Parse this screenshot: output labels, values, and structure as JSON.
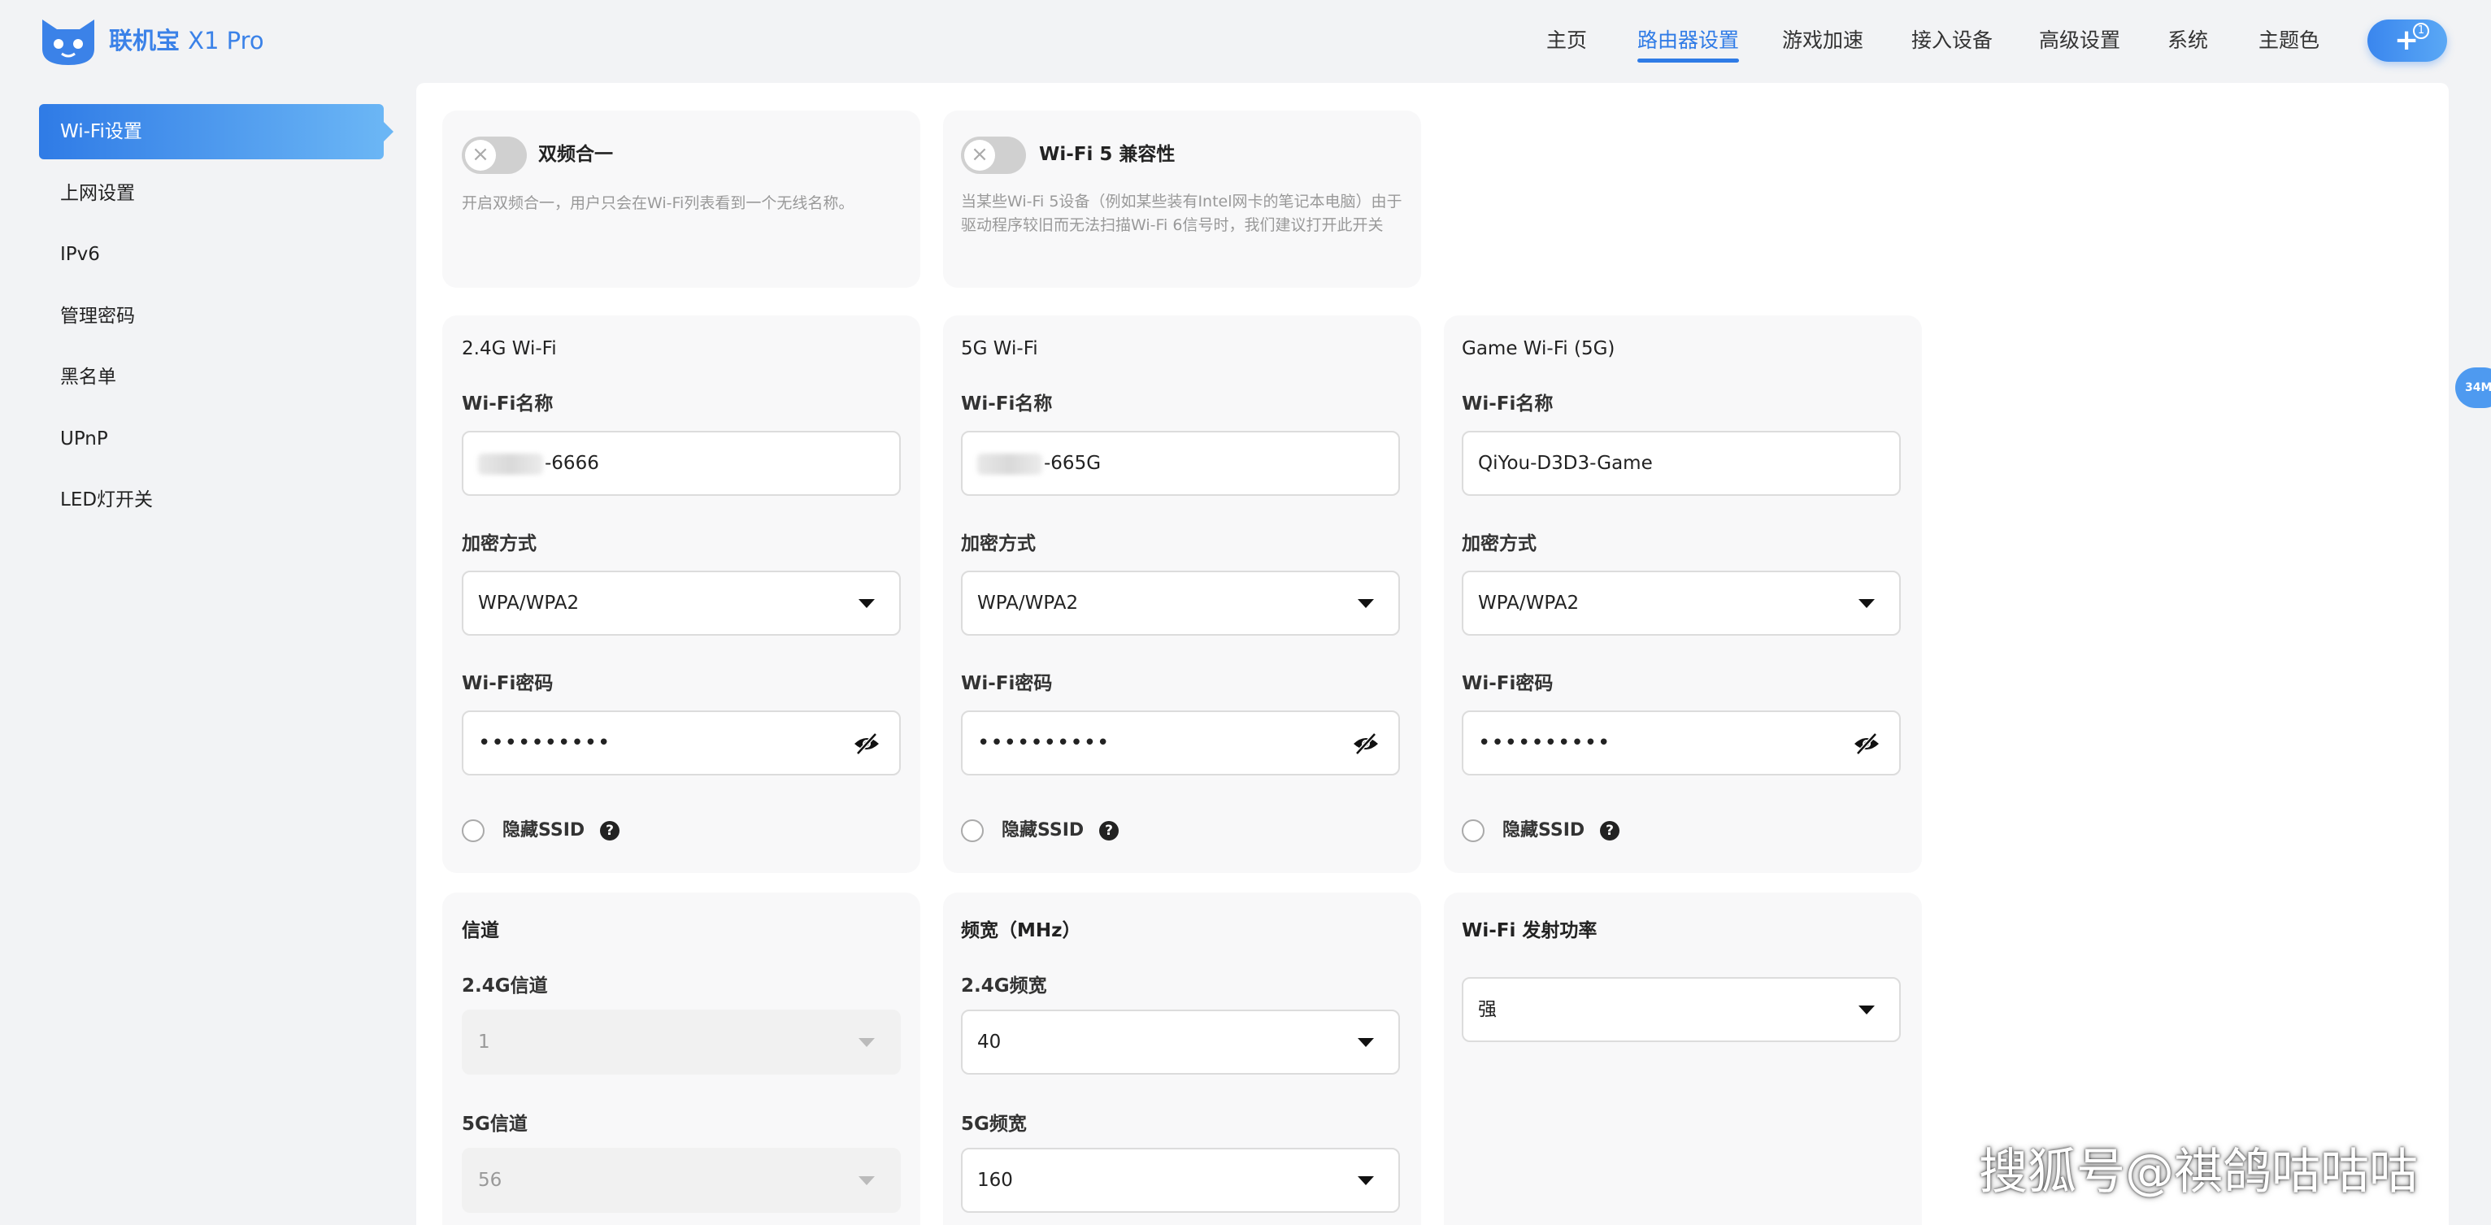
{
  "header": {
    "brand_name": "联机宝",
    "brand_model": "X1 Pro",
    "nav": [
      "主页",
      "路由器设置",
      "游戏加速",
      "接入设备",
      "高级设置",
      "系统",
      "主题色"
    ],
    "nav_active": "路由器设置",
    "plus_badge": "1"
  },
  "sidebar": {
    "items": [
      "Wi-Fi设置",
      "上网设置",
      "IPv6",
      "管理密码",
      "黑名单",
      "UPnP",
      "LED灯开关"
    ],
    "active": "Wi-Fi设置"
  },
  "toggles": {
    "dual_band": {
      "title": "双频合一",
      "on": false,
      "desc": "开启双频合一，用户只会在Wi-Fi列表看到一个无线名称。"
    },
    "wifi5_compat": {
      "title": "Wi-Fi 5 兼容性",
      "on": false,
      "desc": "当某些Wi-Fi 5设备（例如某些装有Intel网卡的笔记本电脑）由于驱动程序较旧而无法扫描Wi-Fi 6信号时，我们建议打开此开关"
    }
  },
  "labels": {
    "wifi_name": "Wi-Fi名称",
    "encryption": "加密方式",
    "wifi_password": "Wi-Fi密码",
    "hide_ssid": "隐藏SSID"
  },
  "networks": [
    {
      "title": "2.4G Wi-Fi",
      "name_suffix": "-6666",
      "name_blurred": true,
      "encryption": "WPA/WPA2",
      "password": "••••••••••",
      "hide_ssid": false
    },
    {
      "title": "5G Wi-Fi",
      "name_suffix": "-665G",
      "name_blurred": true,
      "encryption": "WPA/WPA2",
      "password": "••••••••••",
      "hide_ssid": false
    },
    {
      "title": "Game Wi-Fi (5G)",
      "name": "QiYou-D3D3-Game",
      "name_blurred": false,
      "encryption": "WPA/WPA2",
      "password": "••••••••••",
      "hide_ssid": false
    }
  ],
  "channel": {
    "title": "信道",
    "ch24_label": "2.4G信道",
    "ch24_value": "1",
    "ch5_label": "5G信道",
    "ch5_value": "56"
  },
  "bandwidth": {
    "title": "频宽（MHz）",
    "bw24_label": "2.4G频宽",
    "bw24_value": "40",
    "bw5_label": "5G频宽",
    "bw5_value": "160"
  },
  "tx_power": {
    "title": "Wi-Fi 发射功率",
    "value": "强"
  },
  "edge_tab": "34M",
  "watermark": "搜狐号@祺鸽咕咕咕",
  "colors": {
    "accent": "#2f7be6",
    "logo": "#3b82e8"
  },
  "icons": {
    "logo": "cat-logo-icon",
    "toggle_off": "x-icon",
    "dropdown": "caret-down-icon",
    "password": "eye-slash-icon",
    "help": "question-icon",
    "add": "plus-icon"
  }
}
